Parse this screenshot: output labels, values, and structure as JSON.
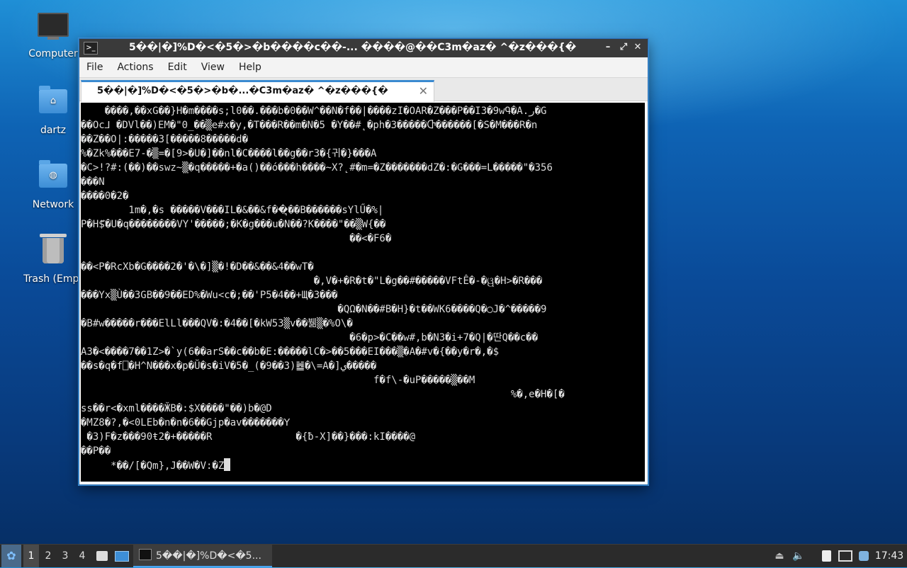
{
  "desktop": {
    "icons": [
      {
        "label": "Computer",
        "icon": "computer-icon"
      },
      {
        "label": "dartz",
        "icon": "home-folder-icon"
      },
      {
        "label": "Network",
        "icon": "network-folder-icon"
      },
      {
        "label": "Trash (Empt",
        "icon": "trash-icon"
      }
    ]
  },
  "window": {
    "title": "5��|�]%D�<�5�>�b����c��-...   ����@��C3m�az� ^�z���{�",
    "controls": {
      "minimize": "–",
      "maximize": "⤢",
      "close": "✕"
    },
    "menu": [
      "File",
      "Actions",
      "Edit",
      "View",
      "Help"
    ],
    "tab": {
      "label": "5��|�]%D�<�5�>�b�...�C3m�az� ^�z���{�",
      "close": "✕"
    }
  },
  "terminal": {
    "lines": [
      "    ����,��xG��}H�m����s;l0��.���b�0��W^��N�f��|����zI�OAR�Z���P��I3�9wԳ�A.ر�G",
      "��Oc⅃ �DVl��)EM�\"0_��▒e#x�y,�T���R��m�N�5 �Y��#˛�ph�3�����Ⴇ������[�S�M���R�n",
      "��Z��O|:�����3[�����8�����d�",
      "%�Zk%���E7-�▒=�[9>�U�]��nl�C����l��g��r3�{귀�}���A",
      "�C>!?#:(��)��swz~▒�q�����+�a()��ó���h����~X?˛#�m=�Z�������dZ�:�G���=L�����\"�356",
      "���N",
      "����0�2�",
      "        1m�,�s �����V���IL�&��&f��͉��B������sYlŰ�%|",
      "P�H$⃗�U�q��������VY'�����;�K�g���u�N��?K����\"��▒W{��",
      "                                             ��<�F6�",
      "",
      "��<P�RcXb�G����2�'�\\�]▒�!�D��&��&4��wT�",
      "                                       �,V�+�R�t�\"L�g��#�����VFtÊ�-�ୱ�H>�R���",
      "���Yx▒Ù��3GB��9��ED%�Wu<c�;��'P5�4��+Щ�3���",
      "                                           �QΩ�N��#B�H}�t��WK6����Q�◯J�^�����9",
      "�B#w�����r���ElLl���QV�:�4��[�kW53▒v��뷂▒�%O\\�",
      "                                             �6�p>�C��w#,b�N3�i+7�Q|�딴Q��c��",
      "A3�<����7��1Z>�`y(6��arS��c��b�E:�����lC�>��5���EI���▒�A�#v�{��y�r�,�$",
      "��s�q�f⎕�H^N���x�p�Ŭ�s�iV�5�_(�9��3)䷹�\\=A�]ي�����",
      "                                                 f�f\\-�uP�����▒��M",
      "                                                                        %�,e�H�[�",
      "ss��r<�xml����ӁB�:$X����\"��)b�@D",
      "�MZ8�?,�<0LEb�n�n�6��Gjp�av�������ꓬ",
      " �3)F�z���90ŧ2�+�����R              �{ƀ-X]��}���:kI����@",
      "��P��",
      "     *��/[�Qm},J��W�V:�Z"
    ]
  },
  "taskbar": {
    "workspaces": [
      "1",
      "2",
      "3",
      "4"
    ],
    "task_label": "5��|�]%D�<�5...",
    "clock": "17:43",
    "tray": [
      "eject-icon",
      "volume-icon",
      "clipboard-icon",
      "network-status-icon",
      "update-notifier-icon"
    ]
  }
}
